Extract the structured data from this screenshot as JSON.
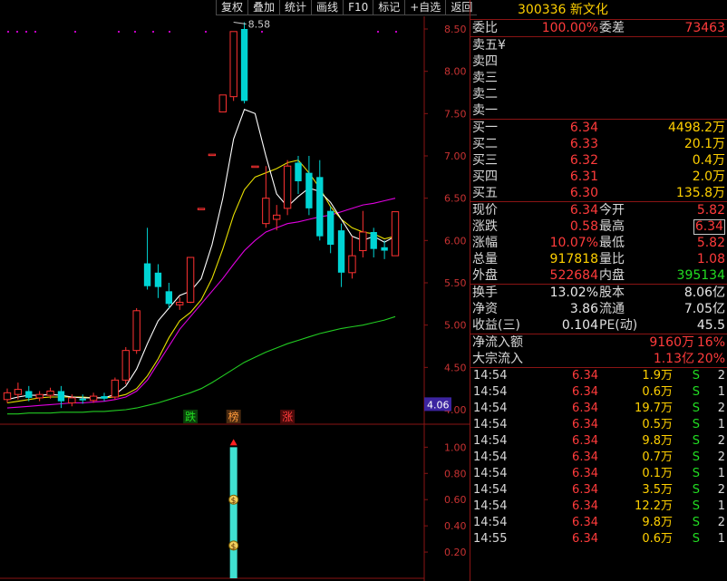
{
  "toolbar": [
    "复权",
    "叠加",
    "统计",
    "画线",
    "F10",
    "标记",
    "+自选",
    "返回"
  ],
  "stock": {
    "code": "300336",
    "name": "新文化"
  },
  "weibi": {
    "label": "委比",
    "value": "100.00%",
    "label2": "委差",
    "value2": "73463"
  },
  "sells": [
    {
      "label": "卖五",
      "note": "¥",
      "price": "",
      "vol": ""
    },
    {
      "label": "卖四",
      "price": "",
      "vol": ""
    },
    {
      "label": "卖三",
      "price": "",
      "vol": ""
    },
    {
      "label": "卖二",
      "price": "",
      "vol": ""
    },
    {
      "label": "卖一",
      "price": "",
      "vol": ""
    }
  ],
  "buys": [
    {
      "label": "买一",
      "price": "6.34",
      "vol": "4498.2万"
    },
    {
      "label": "买二",
      "price": "6.33",
      "vol": "20.1万"
    },
    {
      "label": "买三",
      "price": "6.32",
      "vol": "0.4万"
    },
    {
      "label": "买四",
      "price": "6.31",
      "vol": "2.0万"
    },
    {
      "label": "买五",
      "price": "6.30",
      "vol": "135.8万"
    }
  ],
  "quote": [
    {
      "l1": "现价",
      "v1": "6.34",
      "c1": "red",
      "l2": "今开",
      "v2": "5.82",
      "c2": "red"
    },
    {
      "l1": "涨跌",
      "v1": "0.58",
      "c1": "red",
      "l2": "最高",
      "v2": "6.34",
      "c2": "red",
      "box2": true
    },
    {
      "l1": "涨幅",
      "v1": "10.07%",
      "c1": "red",
      "l2": "最低",
      "v2": "5.82",
      "c2": "red"
    },
    {
      "l1": "总量",
      "v1": "917818",
      "c1": "yel",
      "l2": "量比",
      "v2": "1.08",
      "c2": "red"
    },
    {
      "l1": "外盘",
      "v1": "522684",
      "c1": "red",
      "l2": "内盘",
      "v2": "395134",
      "c2": "grn"
    }
  ],
  "fundamentals": [
    {
      "l1": "换手",
      "v1": "13.02%",
      "l2": "股本",
      "v2": "8.06亿"
    },
    {
      "l1": "净资",
      "v1": "3.86",
      "l2": "流通",
      "v2": "7.05亿"
    },
    {
      "l1": "收益(三)",
      "v1": "0.104",
      "l2": "PE(动)",
      "v2": "45.5"
    }
  ],
  "flows": [
    {
      "label": "净流入额",
      "value": "9160万",
      "pct": "16%"
    },
    {
      "label": "大宗流入",
      "value": "1.13亿",
      "pct": "20%"
    }
  ],
  "trades": [
    {
      "time": "14:54",
      "price": "6.34",
      "vol": "1.9万",
      "dir": "S",
      "cnt": "2"
    },
    {
      "time": "14:54",
      "price": "6.34",
      "vol": "0.6万",
      "dir": "S",
      "cnt": "1"
    },
    {
      "time": "14:54",
      "price": "6.34",
      "vol": "19.7万",
      "dir": "S",
      "cnt": "2"
    },
    {
      "time": "14:54",
      "price": "6.34",
      "vol": "0.5万",
      "dir": "S",
      "cnt": "1"
    },
    {
      "time": "14:54",
      "price": "6.34",
      "vol": "9.8万",
      "dir": "S",
      "cnt": "2"
    },
    {
      "time": "14:54",
      "price": "6.34",
      "vol": "0.7万",
      "dir": "S",
      "cnt": "2"
    },
    {
      "time": "14:54",
      "price": "6.34",
      "vol": "0.1万",
      "dir": "S",
      "cnt": "1"
    },
    {
      "time": "14:54",
      "price": "6.34",
      "vol": "3.5万",
      "dir": "S",
      "cnt": "2"
    },
    {
      "time": "14:54",
      "price": "6.34",
      "vol": "12.2万",
      "dir": "S",
      "cnt": "1"
    },
    {
      "time": "14:54",
      "price": "6.34",
      "vol": "9.8万",
      "dir": "S",
      "cnt": "2"
    },
    {
      "time": "14:55",
      "price": "6.34",
      "vol": "0.6万",
      "dir": "S",
      "cnt": "1"
    }
  ],
  "chart_data": {
    "type": "candlestick",
    "price_axis": {
      "ticks": [
        "8.50",
        "8.00",
        "7.50",
        "7.00",
        "6.50",
        "6.00",
        "5.50",
        "5.00",
        "4.50",
        "4.00"
      ],
      "range": [
        3.85,
        8.65
      ]
    },
    "current_price_tag": "4.06",
    "peak_annotation": "8.58",
    "markers": [
      {
        "text": "跌",
        "color": "#22dd22",
        "index": 17
      },
      {
        "text": "榜",
        "color": "#ff9a3a",
        "index": 21
      },
      {
        "text": "涨",
        "color": "#ff3b3b",
        "index": 26
      }
    ],
    "candles": [
      {
        "o": 4.12,
        "c": 4.2,
        "h": 4.25,
        "l": 4.08
      },
      {
        "o": 4.18,
        "c": 4.24,
        "h": 4.32,
        "l": 4.12
      },
      {
        "o": 4.22,
        "c": 4.14,
        "h": 4.28,
        "l": 4.1
      },
      {
        "o": 4.14,
        "c": 4.18,
        "h": 4.22,
        "l": 4.1
      },
      {
        "o": 4.17,
        "c": 4.22,
        "h": 4.26,
        "l": 4.13
      },
      {
        "o": 4.22,
        "c": 4.1,
        "h": 4.28,
        "l": 4.02
      },
      {
        "o": 4.08,
        "c": 4.14,
        "h": 4.18,
        "l": 4.04
      },
      {
        "o": 4.13,
        "c": 4.11,
        "h": 4.18,
        "l": 4.07
      },
      {
        "o": 4.11,
        "c": 4.16,
        "h": 4.2,
        "l": 4.08
      },
      {
        "o": 4.16,
        "c": 4.13,
        "h": 4.2,
        "l": 4.1
      },
      {
        "o": 4.15,
        "c": 4.35,
        "h": 4.38,
        "l": 4.12
      },
      {
        "o": 4.35,
        "c": 4.7,
        "h": 4.74,
        "l": 4.3
      },
      {
        "o": 4.7,
        "c": 5.17,
        "h": 5.2,
        "l": 4.66
      },
      {
        "o": 5.73,
        "c": 5.46,
        "h": 6.15,
        "l": 5.42
      },
      {
        "o": 5.62,
        "c": 5.45,
        "h": 5.72,
        "l": 5.32
      },
      {
        "o": 5.4,
        "c": 5.25,
        "h": 5.5,
        "l": 5.2
      },
      {
        "o": 5.24,
        "c": 5.27,
        "h": 5.33,
        "l": 5.18
      },
      {
        "o": 5.27,
        "c": 5.8,
        "h": 5.8,
        "l": 5.26
      },
      {
        "o": 6.38,
        "c": 6.38,
        "h": 6.38,
        "l": 6.38
      },
      {
        "o": 7.02,
        "c": 7.02,
        "h": 7.02,
        "l": 7.02
      },
      {
        "o": 7.52,
        "c": 7.72,
        "h": 7.72,
        "l": 7.52
      },
      {
        "o": 7.7,
        "c": 8.47,
        "h": 8.47,
        "l": 7.65
      },
      {
        "o": 8.5,
        "c": 7.65,
        "h": 8.58,
        "l": 7.62
      },
      {
        "o": 6.88,
        "c": 6.88,
        "h": 6.88,
        "l": 6.88
      },
      {
        "o": 6.2,
        "c": 6.5,
        "h": 6.88,
        "l": 6.15
      },
      {
        "o": 6.25,
        "c": 6.3,
        "h": 6.42,
        "l": 6.12
      },
      {
        "o": 6.38,
        "c": 6.88,
        "h": 6.95,
        "l": 6.3
      },
      {
        "o": 6.92,
        "c": 6.7,
        "h": 7.0,
        "l": 6.55
      },
      {
        "o": 6.8,
        "c": 6.38,
        "h": 7.0,
        "l": 6.3
      },
      {
        "o": 6.75,
        "c": 6.05,
        "h": 6.95,
        "l": 6.0
      },
      {
        "o": 6.35,
        "c": 5.95,
        "h": 6.4,
        "l": 5.85
      },
      {
        "o": 6.12,
        "c": 5.62,
        "h": 6.2,
        "l": 5.45
      },
      {
        "o": 5.62,
        "c": 5.82,
        "h": 6.05,
        "l": 5.55
      },
      {
        "o": 5.88,
        "c": 6.1,
        "h": 6.35,
        "l": 5.8
      },
      {
        "o": 6.1,
        "c": 5.9,
        "h": 6.15,
        "l": 5.8
      },
      {
        "o": 5.92,
        "c": 5.88,
        "h": 6.0,
        "l": 5.78
      },
      {
        "o": 5.82,
        "c": 6.34,
        "h": 6.34,
        "l": 5.82
      }
    ],
    "ma_white": [
      4.12,
      4.15,
      4.17,
      4.17,
      4.18,
      4.17,
      4.15,
      4.14,
      4.14,
      4.14,
      4.18,
      4.28,
      4.48,
      4.78,
      5.05,
      5.2,
      5.35,
      5.4,
      5.55,
      5.95,
      6.5,
      7.2,
      7.55,
      7.5,
      7.0,
      6.55,
      6.4,
      6.52,
      6.62,
      6.58,
      6.45,
      6.25,
      6.05,
      6.0,
      6.05,
      5.98,
      6.05
    ],
    "ma_yellow": [
      4.08,
      4.1,
      4.12,
      4.14,
      4.15,
      4.15,
      4.15,
      4.15,
      4.14,
      4.14,
      4.15,
      4.18,
      4.25,
      4.4,
      4.6,
      4.85,
      5.05,
      5.15,
      5.3,
      5.55,
      5.9,
      6.3,
      6.6,
      6.75,
      6.8,
      6.85,
      6.92,
      6.95,
      6.8,
      6.62,
      6.4,
      6.25,
      6.15,
      6.1,
      6.08,
      6.02,
      6.05
    ],
    "ma_magenta": [
      4.02,
      4.03,
      4.04,
      4.05,
      4.06,
      4.07,
      4.08,
      4.08,
      4.09,
      4.1,
      4.12,
      4.15,
      4.22,
      4.35,
      4.55,
      4.75,
      4.95,
      5.1,
      5.25,
      5.4,
      5.55,
      5.72,
      5.88,
      6.0,
      6.1,
      6.15,
      6.2,
      6.22,
      6.25,
      6.28,
      6.3,
      6.34,
      6.38,
      6.42,
      6.44,
      6.47,
      6.5
    ],
    "ma_green": [
      3.95,
      3.95,
      3.96,
      3.96,
      3.96,
      3.97,
      3.97,
      3.97,
      3.98,
      3.98,
      3.99,
      4.0,
      4.02,
      4.05,
      4.08,
      4.12,
      4.16,
      4.2,
      4.25,
      4.32,
      4.4,
      4.48,
      4.56,
      4.62,
      4.68,
      4.73,
      4.78,
      4.82,
      4.86,
      4.9,
      4.93,
      4.96,
      4.98,
      5.0,
      5.03,
      5.06,
      5.1
    ],
    "indicator": {
      "ticks": [
        "1.00",
        "0.80",
        "0.60",
        "0.40",
        "0.20"
      ],
      "range": [
        0,
        1.12
      ],
      "bar_index": 21,
      "bar_value": 1.0
    }
  }
}
